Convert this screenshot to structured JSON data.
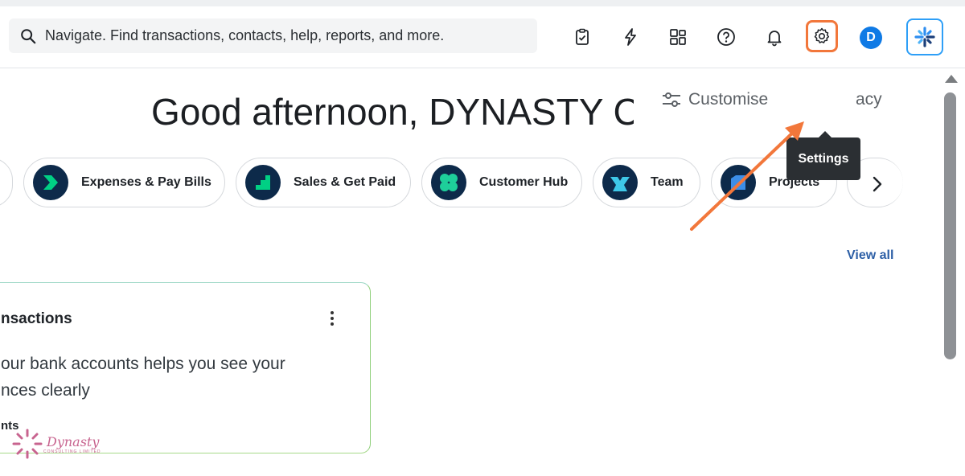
{
  "search": {
    "placeholder": "Navigate. Find transactions, contacts, help, reports, and more."
  },
  "topbar": {
    "icons": [
      "clipboard-check-icon",
      "lightning-icon",
      "apps-icon",
      "help-icon",
      "bell-icon",
      "gear-icon"
    ],
    "avatar_letter": "D",
    "tooltip": "Settings"
  },
  "header": {
    "greeting": "Good afternoon, DYNASTY CONSULTING!",
    "customise": "Customise",
    "privacy": "acy"
  },
  "shortcuts": [
    {
      "label": "Expenses & Pay Bills",
      "icon": "chevron-right-icon",
      "color": "#00d084"
    },
    {
      "label": "Sales & Get Paid",
      "icon": "stairs-icon",
      "color": "#00d084"
    },
    {
      "label": "Customer Hub",
      "icon": "clover-icon",
      "color": "#1ecf9a"
    },
    {
      "label": "Team",
      "icon": "team-icon",
      "color": "#3ec8e8"
    },
    {
      "label": "Projects",
      "icon": "folder-icon",
      "color": "#3c8ee8"
    }
  ],
  "view_all": "View all",
  "card": {
    "title": "nsactions",
    "body_line1": "our bank accounts helps you see your",
    "body_line2": "nces clearly",
    "footer": "nts"
  },
  "watermark": {
    "text": "Dynasty",
    "sub": "CONSULTING LIMITED"
  },
  "colors": {
    "accent_orange": "#f2773b",
    "avatar_blue": "#0f7ae5",
    "link_blue": "#2d5fa6"
  }
}
